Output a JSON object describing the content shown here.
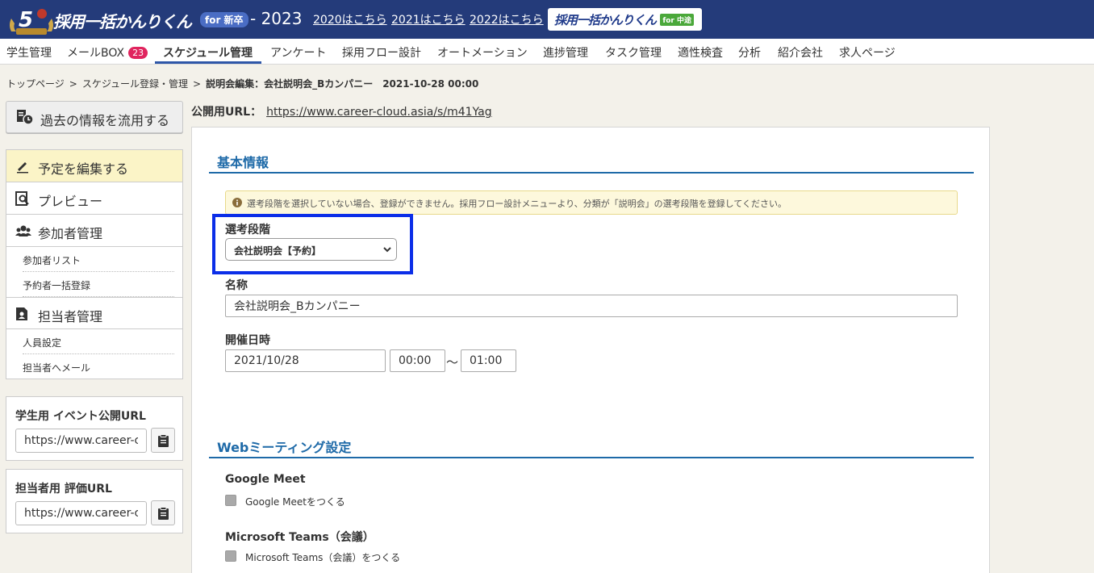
{
  "header": {
    "logo_text": "採用一括かんりくん",
    "logo_for": "for 新卒",
    "year": "- 2023",
    "year_links": [
      "2020はこちら",
      "2021はこちら",
      "2022はこちら"
    ],
    "midcareer_text": "採用一括かんりくん",
    "midcareer_badge": "for 中途",
    "badge_number": "5"
  },
  "nav": {
    "items": [
      "学生管理",
      "メールBOX",
      "スケジュール管理",
      "アンケート",
      "採用フロー設計",
      "オートメーション",
      "進捗管理",
      "タスク管理",
      "適性検査",
      "分析",
      "紹介会社",
      "求人ページ"
    ],
    "mail_count": "23",
    "active": "スケジュール管理"
  },
  "breadcrumb": {
    "home": "トップページ",
    "sep": ">",
    "parent": "スケジュール登録・管理",
    "current": "説明会編集：会社説明会_Bカンパニー　2021-10-28 00:00"
  },
  "sidebar": {
    "reuse_label": "過去の情報を流用する",
    "menu": {
      "edit": "予定を編集する",
      "preview": "プレビュー",
      "participants": "参加者管理",
      "participant_list": "参加者リスト",
      "bulk_register": "予約者一括登録",
      "staff": "担当者管理",
      "staffing": "人員設定",
      "mail_staff": "担当者へメール"
    },
    "student_url": {
      "title": "学生用 イベント公開URL",
      "value": "https://www.career-c"
    },
    "staff_url": {
      "title": "担当者用 評価URL",
      "value": "https://www.career-c"
    }
  },
  "main": {
    "public_url_label": "公開用URL：",
    "public_url": "https://www.career-cloud.asia/s/m41Yag",
    "basic": {
      "title": "基本情報",
      "notice": "選考段階を選択していない場合、登録ができません。採用フロー設計メニューより、分類が「説明会」の選考段階を登録してください。",
      "stage_label": "選考段階",
      "stage_value": "会社説明会【予約】",
      "name_label": "名称",
      "name_value": "会社説明会_Bカンパニー",
      "datetime_label": "開催日時",
      "date_value": "2021/10/28",
      "start_value": "00:00",
      "tilde": "〜",
      "end_value": "01:00"
    },
    "web": {
      "title": "Webミーティング設定",
      "google_heading": "Google Meet",
      "google_check": "Google Meetをつくる",
      "teams_heading": "Microsoft Teams（会議）",
      "teams_check": "Microsoft Teams（会議）をつくる"
    }
  },
  "colors": {
    "header_bg": "#243b7a",
    "accent": "#1e6aa8",
    "highlight_border": "#0b2ee8",
    "badge": "#e0245e"
  }
}
